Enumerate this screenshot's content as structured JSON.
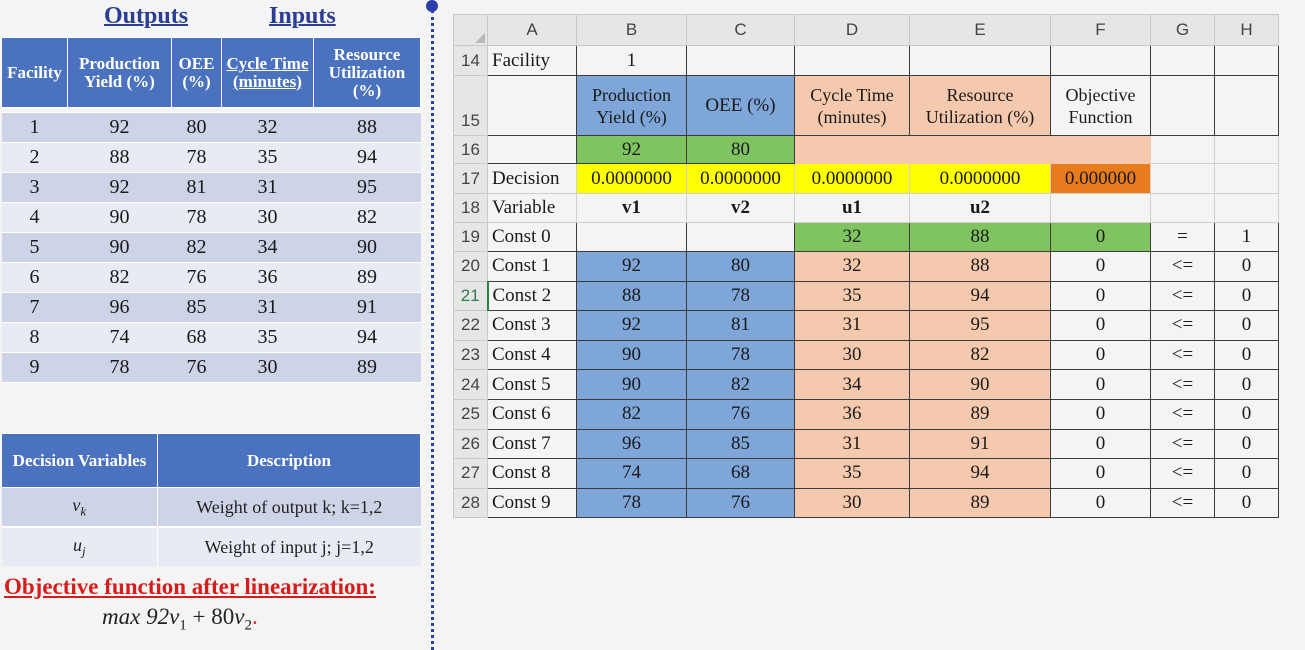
{
  "left": {
    "outputs_label": "Outputs",
    "inputs_label": "Inputs",
    "facility_table": {
      "headers": [
        "Facility",
        "Production Yield (%)",
        "OEE (%)",
        "Cycle Time (minutes)",
        "Resource Utilization (%)"
      ],
      "rows": [
        [
          "1",
          "92",
          "80",
          "32",
          "88"
        ],
        [
          "2",
          "88",
          "78",
          "35",
          "94"
        ],
        [
          "3",
          "92",
          "81",
          "31",
          "95"
        ],
        [
          "4",
          "90",
          "78",
          "30",
          "82"
        ],
        [
          "5",
          "90",
          "82",
          "34",
          "90"
        ],
        [
          "6",
          "82",
          "76",
          "36",
          "89"
        ],
        [
          "7",
          "96",
          "85",
          "31",
          "91"
        ],
        [
          "8",
          "74",
          "68",
          "35",
          "94"
        ],
        [
          "9",
          "78",
          "76",
          "30",
          "89"
        ]
      ]
    },
    "variables_table": {
      "headers": [
        "Decision Variables",
        "Description"
      ],
      "rows": [
        {
          "symbol": "v",
          "sub": "k",
          "description": "Weight of output k; k=1,2"
        },
        {
          "symbol": "u",
          "sub": "j",
          "description": "Weight of input j; j=1,2"
        }
      ]
    },
    "objective_title": "Objective function after linearization:",
    "objective_formula": {
      "prefix": "max 92",
      "v1": "v",
      "s1": "1",
      "mid": " + 80",
      "v2": "v",
      "s2": "2"
    }
  },
  "sheet": {
    "columns": [
      "A",
      "B",
      "C",
      "D",
      "E",
      "F",
      "G",
      "H"
    ],
    "rows": {
      "r14": {
        "num": "14",
        "a": "Facility",
        "b": "1"
      },
      "r15": {
        "num": "15",
        "b": "Production Yield (%)",
        "c": "OEE (%)",
        "d": "Cycle Time (minutes)",
        "e": "Resource Utilization (%)",
        "f": "Objective Function"
      },
      "r16": {
        "num": "16",
        "b": "92",
        "c": "80"
      },
      "r17": {
        "num": "17",
        "a": "Decision",
        "b": "0.0000000",
        "c": "0.0000000",
        "d": "0.0000000",
        "e": "0.0000000",
        "f": "0.000000"
      },
      "r18": {
        "num": "18",
        "a": "Variable",
        "b": "v1",
        "c": "v2",
        "d": "u1",
        "e": "u2"
      },
      "r19": {
        "num": "19",
        "a": "Const 0",
        "d": "32",
        "e": "88",
        "f": "0",
        "g": "=",
        "h": "1"
      }
    },
    "constraints": [
      {
        "num": "20",
        "a": "Const 1",
        "b": "92",
        "c": "80",
        "d": "32",
        "e": "88",
        "f": "0",
        "g": "<=",
        "h": "0"
      },
      {
        "num": "21",
        "a": "Const 2",
        "b": "88",
        "c": "78",
        "d": "35",
        "e": "94",
        "f": "0",
        "g": "<=",
        "h": "0"
      },
      {
        "num": "22",
        "a": "Const 3",
        "b": "92",
        "c": "81",
        "d": "31",
        "e": "95",
        "f": "0",
        "g": "<=",
        "h": "0"
      },
      {
        "num": "23",
        "a": "Const 4",
        "b": "90",
        "c": "78",
        "d": "30",
        "e": "82",
        "f": "0",
        "g": "<=",
        "h": "0"
      },
      {
        "num": "24",
        "a": "Const 5",
        "b": "90",
        "c": "82",
        "d": "34",
        "e": "90",
        "f": "0",
        "g": "<=",
        "h": "0"
      },
      {
        "num": "25",
        "a": "Const 6",
        "b": "82",
        "c": "76",
        "d": "36",
        "e": "89",
        "f": "0",
        "g": "<=",
        "h": "0"
      },
      {
        "num": "26",
        "a": "Const 7",
        "b": "96",
        "c": "85",
        "d": "31",
        "e": "91",
        "f": "0",
        "g": "<=",
        "h": "0"
      },
      {
        "num": "27",
        "a": "Const 8",
        "b": "74",
        "c": "68",
        "d": "35",
        "e": "94",
        "f": "0",
        "g": "<=",
        "h": "0"
      },
      {
        "num": "28",
        "a": "Const 9",
        "b": "78",
        "c": "76",
        "d": "30",
        "e": "89",
        "f": "0",
        "g": "<=",
        "h": "0"
      }
    ]
  },
  "colors": {
    "table_header_blue": "#4a72be",
    "title_blue": "#2a3e96",
    "objective_red": "#d81b1b",
    "cell_blue": "#7ea6d8",
    "cell_peach": "#f5c9ad",
    "cell_green": "#7fc460",
    "cell_yellow": "#ffff00",
    "cell_orange": "#e87c1c"
  }
}
